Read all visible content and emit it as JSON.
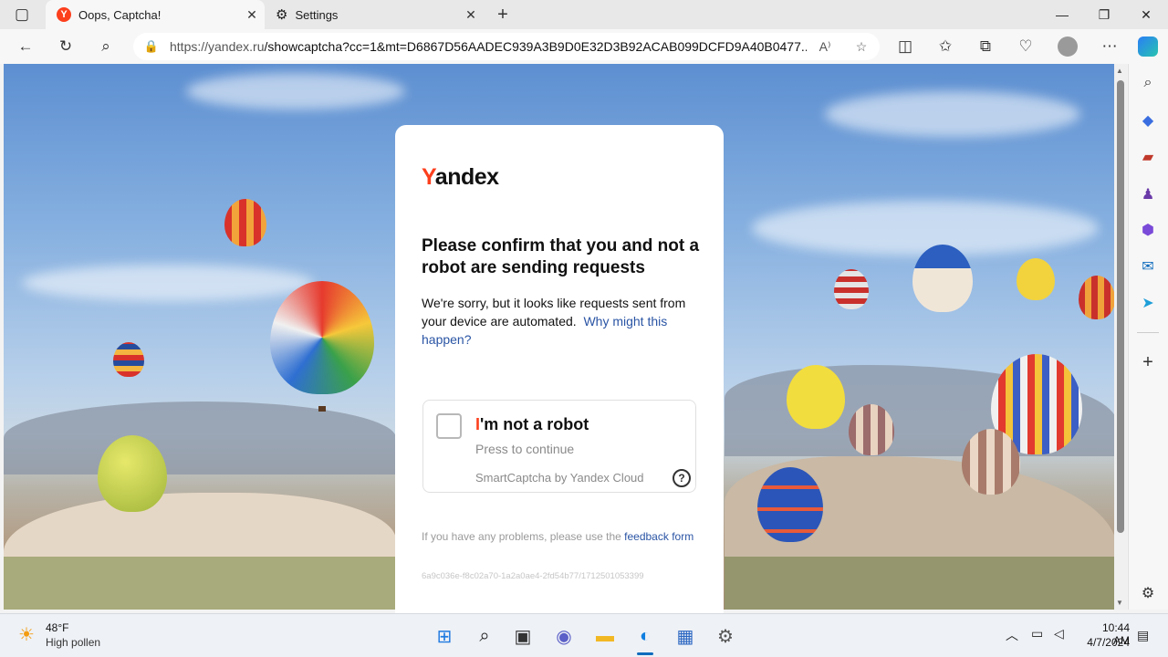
{
  "browser": {
    "tabs": [
      {
        "title": "Oops, Captcha!",
        "active": true
      },
      {
        "title": "Settings",
        "active": false
      }
    ],
    "address": {
      "host": "https://yandex.ru",
      "path": "/showcaptcha?cc=1&mt=D6867D56AADEC939A3B9D0E32D3B92ACAB099DCFD9A40B0477..."
    }
  },
  "captcha": {
    "logo_first": "Y",
    "logo_rest": "andex",
    "heading": "Please confirm that you and not a robot are sending requests",
    "description": "We're sorry, but it looks like requests sent from your device are automated.",
    "why_link": "Why might this happen?",
    "label_first": "I",
    "label_rest": "'m not a robot",
    "press": "Press to continue",
    "powered": "SmartCaptcha by Yandex Cloud",
    "help": "?",
    "problems_text": "If you have any problems, please use the",
    "feedback_link": "feedback form",
    "request_id": "6a9c036e-f8c02a70-1a2a0ae4-2fd54b77/1712501053399"
  },
  "taskbar": {
    "weather_temp": "48°F",
    "weather_desc": "High pollen",
    "time": "10:44 AM",
    "date": "4/7/2024"
  },
  "colors": {
    "yandex_red": "#fc3f1d",
    "link_blue": "#2a54a4"
  }
}
